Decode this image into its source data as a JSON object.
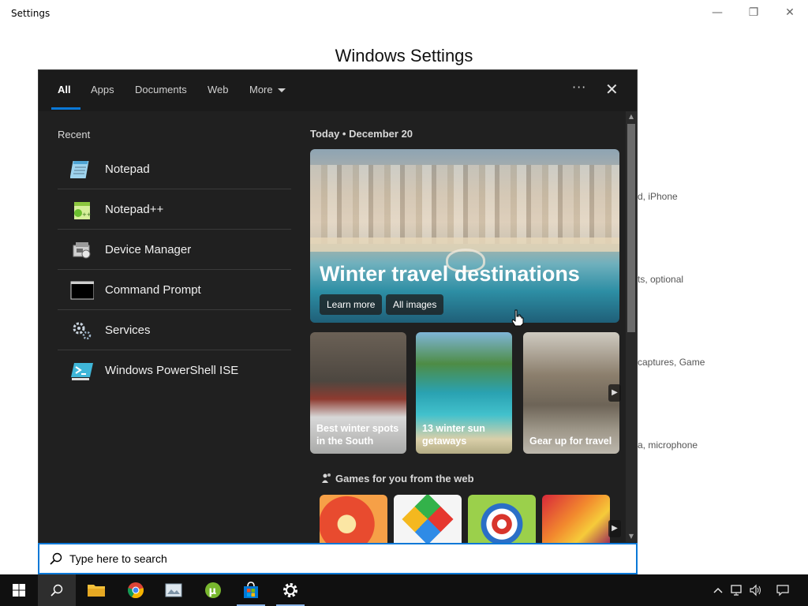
{
  "window": {
    "title": "Settings",
    "minimize_glyph": "—",
    "restore_glyph": "❐",
    "close_glyph": "✕",
    "heading": "Windows Settings",
    "background_items": [
      "d, iPhone",
      "ts, optional",
      "captures, Game",
      "a, microphone"
    ]
  },
  "panel": {
    "tabs": [
      "All",
      "Apps",
      "Documents",
      "Web",
      "More"
    ],
    "active_tab": "All",
    "options_glyph": "···",
    "close_glyph": "✕",
    "recent_label": "Recent",
    "recent": [
      {
        "name": "Notepad",
        "icon": "notepad-icon"
      },
      {
        "name": "Notepad++",
        "icon": "notepad-plus-plus-icon"
      },
      {
        "name": "Device Manager",
        "icon": "device-manager-icon"
      },
      {
        "name": "Command Prompt",
        "icon": "command-prompt-icon"
      },
      {
        "name": "Services",
        "icon": "services-gear-icon"
      },
      {
        "name": "Windows PowerShell ISE",
        "icon": "powershell-ise-icon"
      }
    ],
    "today": "Today  •  December 20",
    "hero": {
      "title": "Winter travel destinations",
      "learn_more": "Learn more",
      "all_images": "All images"
    },
    "cards": [
      {
        "line1": "Best winter spots",
        "line2": "in the South"
      },
      {
        "line1": "13 winter sun",
        "line2": "getaways"
      },
      {
        "line1": "Gear up for travel",
        "line2": ""
      }
    ],
    "arrow_glyph": "▶",
    "games_label": "Games for you from the web",
    "games": [
      "bowling-game-icon",
      "color-diamond-game-icon",
      "archery-game-icon",
      "racing-game-icon"
    ],
    "scroll_up_glyph": "▲",
    "scroll_down_glyph": "▼"
  },
  "search": {
    "placeholder": "Type here to search"
  },
  "taskbar": {
    "items": [
      "start-icon",
      "search-icon",
      "file-explorer-icon",
      "chrome-icon",
      "photos-icon",
      "utorrent-icon",
      "store-icon",
      "settings-icon"
    ],
    "tray": [
      "chevron-up-icon",
      "network-icon",
      "volume-icon",
      "notification-icon"
    ]
  },
  "colors": {
    "accent": "#0a78d7",
    "panel_bg": "#202020",
    "taskbar_bg": "#101010"
  }
}
